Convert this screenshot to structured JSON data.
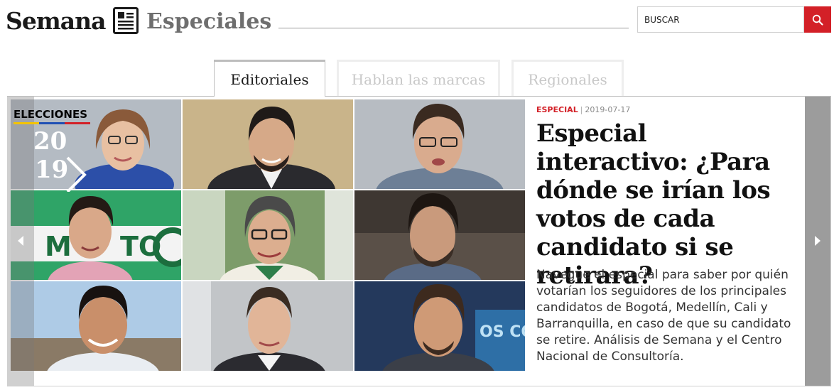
{
  "header": {
    "brand": "Semana",
    "section": "Especiales",
    "search_placeholder": "BUSCAR"
  },
  "tabs": [
    {
      "label": "Editoriales",
      "active": true
    },
    {
      "label": "Hablan las marcas",
      "active": false
    },
    {
      "label": "Regionales",
      "active": false
    }
  ],
  "badge": {
    "line1": "ELECCIONES",
    "year_top": "20",
    "year_bottom": "19",
    "stripe_colors": [
      "#f5c400",
      "#1f4fb4",
      "#d32027"
    ]
  },
  "article": {
    "kicker": "ESPECIAL",
    "separator": "|",
    "date": "2019-07-17",
    "title": "Especial interactivo: ¿Para dónde se irían los votos de cada candidato si se retirara?",
    "summary": "Navegue el especial para saber por quién votarían los seguidores de los principales candidatos de Bogotá, Medellín, Cali y Barranquilla, en caso de que su candidato se retire. Análisis de Semana y el Centro Nacional de Consultoría."
  },
  "colors": {
    "accent": "#d32027",
    "text": "#111111",
    "muted_tab": "#c8c8c8"
  },
  "icons": [
    "newspaper-icon",
    "search-icon",
    "chevron-left-icon",
    "chevron-right-icon"
  ]
}
